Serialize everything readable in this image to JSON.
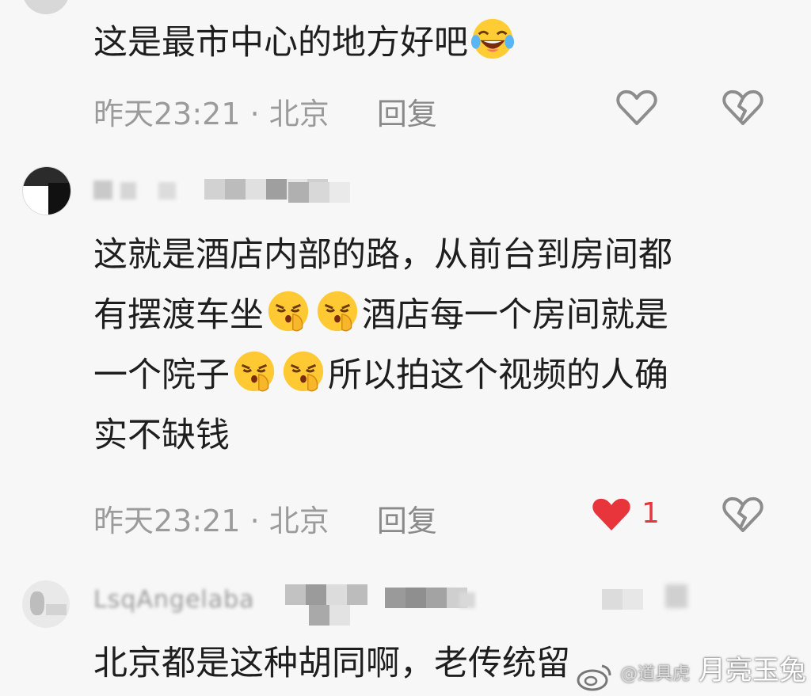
{
  "comments": [
    {
      "text_line1": "这是最市中心的地方好吧",
      "time": "昨天23:21",
      "separator": "·",
      "location": "北京",
      "reply_label": "回复",
      "liked": false
    },
    {
      "line1": "这就是酒店内部的路，从前台到房间都",
      "line2a": "有摆渡车坐",
      "line2b": "酒店每一个房间就是",
      "line3a": "一个院子",
      "line3b": "所以拍这个视频的人确",
      "line4": "实不缺钱",
      "time": "昨天23:21",
      "separator": "·",
      "location": "北京",
      "reply_label": "回复",
      "liked": true,
      "like_count": "1"
    },
    {
      "username": "LsqAngelaba",
      "text": "北京都是这种胡同啊，老传统留"
    }
  ],
  "watermark": {
    "text": "月亮玉兔",
    "sub": "@道具虎"
  },
  "colors": {
    "like_active": "#e8343b",
    "meta": "#9b9b9b"
  }
}
